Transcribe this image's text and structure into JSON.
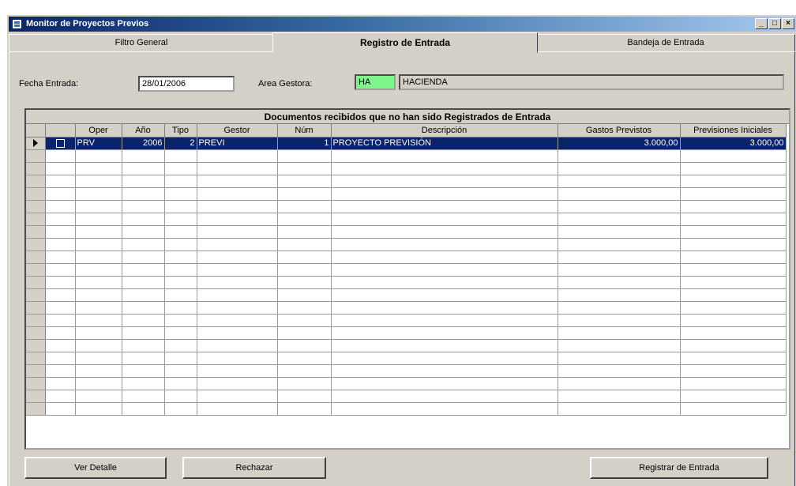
{
  "window": {
    "title": "Monitor de Proyectos Previos",
    "controls": {
      "minimize": "_",
      "maximize": "□",
      "close": "×"
    }
  },
  "tabs": [
    {
      "label": "Filtro General",
      "active": false
    },
    {
      "label": "Registro de Entrada",
      "active": true
    },
    {
      "label": "Bandeja de Entrada",
      "active": false
    }
  ],
  "form": {
    "fecha_label": "Fecha Entrada:",
    "fecha_value": "28/01/2006",
    "area_label": "Area Gestora:",
    "area_code": "HA",
    "area_name": "HACIENDA"
  },
  "grid": {
    "caption": "Documentos recibidos que no han sido Registrados de Entrada",
    "columns": [
      "",
      "Oper",
      "Año",
      "Tipo",
      "Gestor",
      "Núm",
      "Descripción",
      "Gastos Previstos",
      "Previsiones Iniciales"
    ],
    "rows": [
      {
        "oper": "PRV",
        "anio": "2006",
        "tipo": "2",
        "gestor": "PREVI",
        "num": "1",
        "descripcion": "PROYECTO PREVISIÓN",
        "gastos": "3.000,00",
        "previsiones": "3.000,00"
      }
    ]
  },
  "buttons": {
    "detalle": "Ver Detalle",
    "rechazar": "Rechazar",
    "registrar": "Registrar de Entrada"
  }
}
